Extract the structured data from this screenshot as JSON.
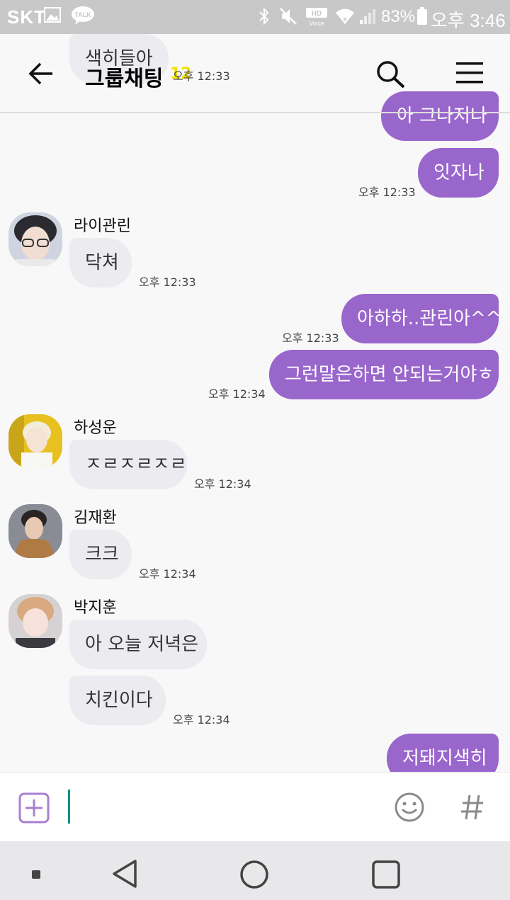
{
  "status_bar": {
    "carrier": "SKT",
    "battery": "83%",
    "time": "오후 3:46",
    "icons": [
      "image-icon",
      "talk-icon",
      "bluetooth-icon",
      "mute-icon",
      "hd-voice-icon",
      "wifi-icon",
      "signal-icon",
      "battery-icon"
    ]
  },
  "header": {
    "back_icon": "arrow-left-icon",
    "title": "그룹채팅",
    "member_count": "12",
    "search_icon": "search-icon",
    "menu_icon": "hamburger-menu-icon"
  },
  "messages": [
    {
      "id": "m0",
      "from": "self-hidden",
      "text": "색히들아",
      "time": "오후 12:33"
    },
    {
      "id": "m1",
      "from": "me",
      "text": "아 그나저나"
    },
    {
      "id": "m2",
      "from": "me",
      "text": "잇자나",
      "time": "오후 12:33"
    },
    {
      "id": "m3",
      "from": "라이관린",
      "text": "닥쳐",
      "time": "오후 12:33"
    },
    {
      "id": "m4",
      "from": "me",
      "text": "아하하..관린아^^",
      "time": "오후 12:33"
    },
    {
      "id": "m5",
      "from": "me",
      "text": "그런말은하면 안되는거야ㅎ",
      "time": "오후 12:34"
    },
    {
      "id": "m6",
      "from": "하성운",
      "text": "ㅈㄹㅈㄹㅈㄹ",
      "time": "오후 12:34"
    },
    {
      "id": "m7",
      "from": "김재환",
      "text": "크크",
      "time": "오후 12:34"
    },
    {
      "id": "m8",
      "from": "박지훈",
      "text": "아 오늘 저녁은"
    },
    {
      "id": "m9",
      "from": "박지훈",
      "text": "치킨이다",
      "time": "오후 12:34"
    },
    {
      "id": "m10",
      "from": "me",
      "text": "저돼지색히"
    }
  ],
  "senders": {
    "lai": "라이관린",
    "ha": "하성운",
    "kim": "김재환",
    "park": "박지훈"
  },
  "composer": {
    "add_icon": "plus-square-icon",
    "emoji_icon": "smiley-icon",
    "hashtag_icon": "hashtag-icon",
    "value": ""
  },
  "navbar": {
    "icons": [
      "dot-icon",
      "back-triangle-icon",
      "home-circle-icon",
      "recents-square-icon"
    ]
  },
  "colors": {
    "my_bubble": "#9966cc",
    "their_bubble": "#ecebef",
    "caret": "#0e8f80",
    "count_badge": "#f4e000"
  }
}
